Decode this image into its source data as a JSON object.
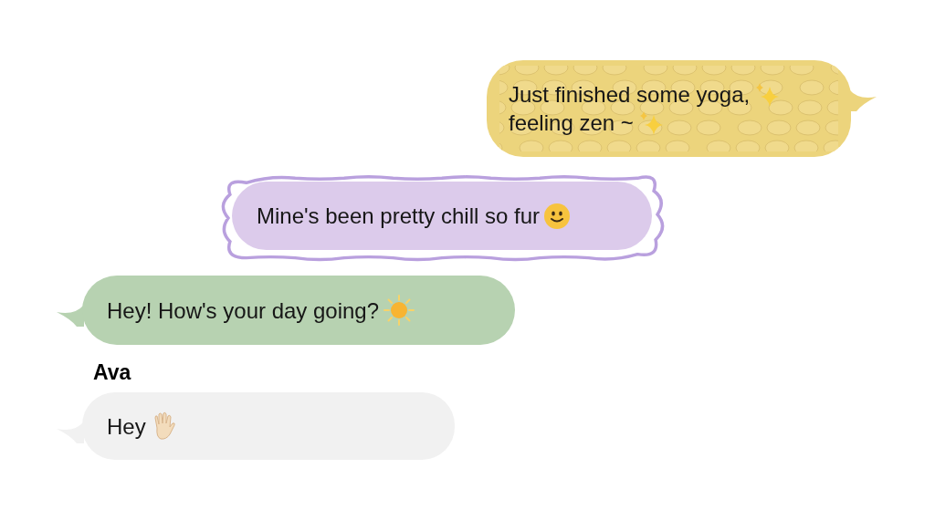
{
  "messages": [
    {
      "kind": "textured",
      "lines": [
        "Just finished some yoga,",
        "feeling zen ~"
      ]
    },
    {
      "kind": "framed",
      "lines": [
        "Mine's been pretty chill so fur"
      ]
    },
    {
      "kind": "green",
      "lines": [
        "Hey! How's your day going?"
      ]
    },
    {
      "kind": "plain",
      "sender": "Ava",
      "lines": [
        "Hey"
      ]
    }
  ]
}
